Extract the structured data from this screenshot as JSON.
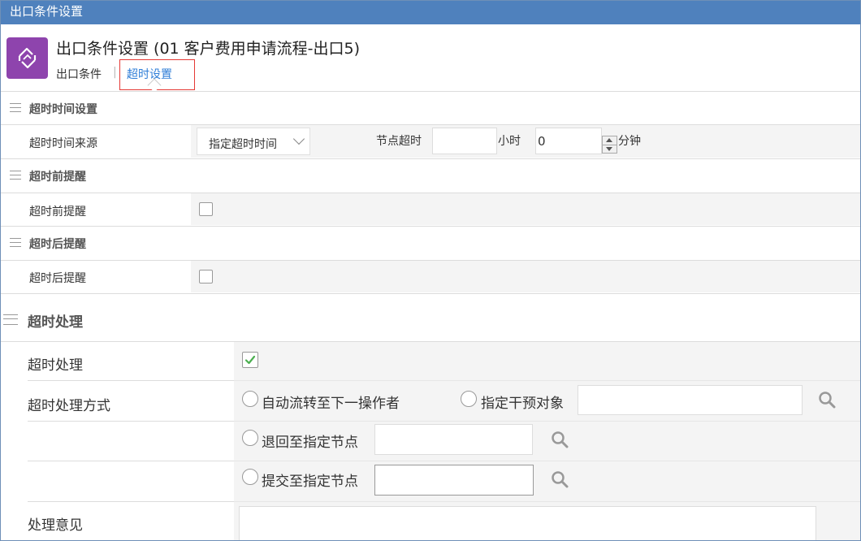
{
  "window": {
    "title": "出口条件设置"
  },
  "header": {
    "title": "出口条件设置 (01 客户费用申请流程-出口5)",
    "tabs": [
      {
        "label": "出口条件",
        "active": false
      },
      {
        "label": "超时设置",
        "active": true
      }
    ],
    "tab_separator": "|"
  },
  "timeout_time": {
    "section_title": "超时时间设置",
    "source_label": "超时时间来源",
    "source_value": "指定超时时间",
    "node_timeout_label": "节点超时",
    "hours_value": "",
    "hours_unit": "小时",
    "minutes_value": "0",
    "minutes_unit": "分钟"
  },
  "before_reminder": {
    "section_title": "超时前提醒",
    "label": "超时前提醒",
    "checked": false
  },
  "after_reminder": {
    "section_title": "超时后提醒",
    "label": "超时后提醒",
    "checked": false
  },
  "timeout_handling": {
    "section_title": "超时处理",
    "enable_label": "超时处理",
    "enabled": true,
    "method_label": "超时处理方式",
    "options": [
      {
        "label": "自动流转至下一操作者",
        "selected": false
      },
      {
        "label": "指定干预对象",
        "selected": false,
        "value": ""
      },
      {
        "label": "退回至指定节点",
        "selected": false,
        "value": ""
      },
      {
        "label": "提交至指定节点",
        "selected": false,
        "value": ""
      }
    ],
    "opinion_label": "处理意见",
    "opinion_value": ""
  },
  "colors": {
    "titlebar": "#4f81bd",
    "app_icon": "#8e44ad",
    "active_tab_text": "#2e7dd7",
    "active_tab_border": "#e53935",
    "check_green": "#4caf50"
  }
}
